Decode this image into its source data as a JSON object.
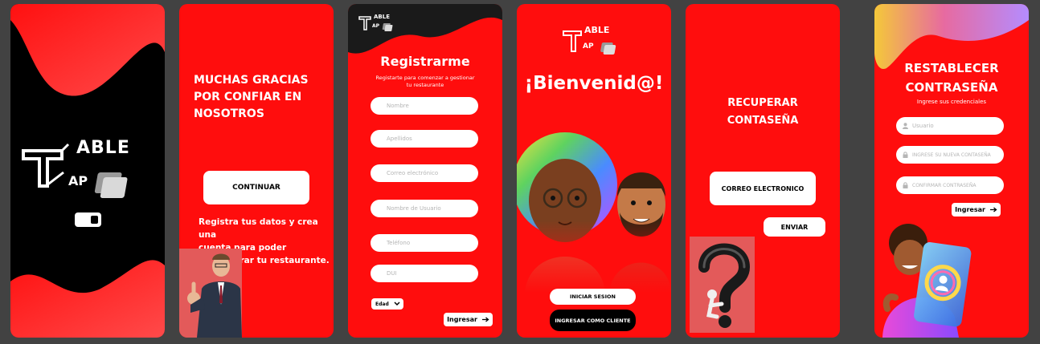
{
  "brand": {
    "logo_top": "ABLE",
    "logo_bottom": "AP",
    "logo_initial": "T"
  },
  "screen2": {
    "heading_line1": "MUCHAS GRACIAS",
    "heading_line2": "POR CONFIAR EN",
    "heading_line3": "NOSOTROS",
    "continue_label": "CONTINUAR",
    "body_line1": "Registra tus datos y crea una",
    "body_line2": "cuenta para poder",
    "body_line3": "administrar tu restaurante."
  },
  "screen3": {
    "title": "Registrarme",
    "subtitle_line1": "Registarte para comenzar a gestionar",
    "subtitle_line2": "tu restaurante",
    "fields": {
      "nombre": "Nombre",
      "apellidos": "Apellidos",
      "correo": "Correo electrónico",
      "usuario": "Nombre de Usuario",
      "telefono": "Teléfono",
      "dui": "DUI"
    },
    "age_select": "Edad",
    "submit_label": "Ingresar"
  },
  "screen4": {
    "title": "¡Bienvenid@!",
    "login_label": "INICIAR SESION",
    "client_label": "INGRESAR COMO CLIENTE"
  },
  "screen5": {
    "heading_line1": "RECUPERAR",
    "heading_line2": "CONTASEÑA",
    "email_label": "CORREO ELECTRONICO",
    "send_label": "ENVIAR"
  },
  "screen6": {
    "heading_line1": "RESTABLECER",
    "heading_line2": "CONTRASEÑA",
    "subtitle": "Ingrese sus credenciales",
    "fields": {
      "usuario": "Usuario",
      "nueva": "INGRESE SU NUEVA CONTASEÑA",
      "confirmar": "CONFIRMAR CONTRASEÑA"
    },
    "submit_label": "Ingresar"
  },
  "colors": {
    "brand_red": "#ff0d0d",
    "background": "#424242",
    "black": "#000000",
    "white": "#ffffff"
  },
  "icons": [
    "toggle-icon",
    "arrow-right-icon",
    "chevron-down-icon",
    "user-icon",
    "lock-icon",
    "logo-card-icon"
  ]
}
